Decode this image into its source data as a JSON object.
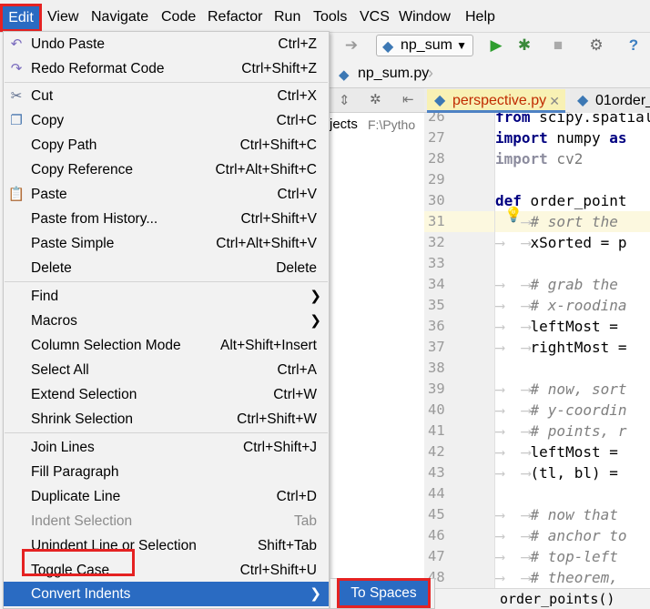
{
  "menubar": [
    "Edit",
    "View",
    "Navigate",
    "Code",
    "Refactor",
    "Run",
    "Tools",
    "VCS",
    "Window",
    "Help"
  ],
  "toolbar": {
    "run_config": "np_sum",
    "arrow_icon": "arrow-right-icon",
    "run_icon": "play-icon",
    "debug_icon": "bug-icon",
    "stop_icon": "stop-icon",
    "settings_icon": "wrench-icon",
    "help_icon": "question-icon"
  },
  "navbar": {
    "file": "np_sum.py"
  },
  "project": {
    "label": "jects",
    "path": "F:\\Pytho"
  },
  "tabs": [
    "perspective.py",
    "01order_"
  ],
  "menu": {
    "items": [
      {
        "label": "Undo Paste",
        "shortcut": "Ctrl+Z",
        "icon": "undo-icon"
      },
      {
        "label": "Redo Reformat Code",
        "shortcut": "Ctrl+Shift+Z",
        "icon": "redo-icon"
      },
      {
        "label": "Cut",
        "shortcut": "Ctrl+X",
        "icon": "scissors-icon"
      },
      {
        "label": "Copy",
        "shortcut": "Ctrl+C",
        "icon": "copy-icon"
      },
      {
        "label": "Copy Path",
        "shortcut": "Ctrl+Shift+C"
      },
      {
        "label": "Copy Reference",
        "shortcut": "Ctrl+Alt+Shift+C"
      },
      {
        "label": "Paste",
        "shortcut": "Ctrl+V",
        "icon": "paste-icon"
      },
      {
        "label": "Paste from History...",
        "shortcut": "Ctrl+Shift+V"
      },
      {
        "label": "Paste Simple",
        "shortcut": "Ctrl+Alt+Shift+V"
      },
      {
        "label": "Delete",
        "shortcut": "Delete"
      },
      {
        "label": "Find",
        "shortcut": ""
      },
      {
        "label": "Macros",
        "shortcut": ""
      },
      {
        "label": "Column Selection Mode",
        "shortcut": "Alt+Shift+Insert"
      },
      {
        "label": "Select All",
        "shortcut": "Ctrl+A"
      },
      {
        "label": "Extend Selection",
        "shortcut": "Ctrl+W"
      },
      {
        "label": "Shrink Selection",
        "shortcut": "Ctrl+Shift+W"
      },
      {
        "label": "Join Lines",
        "shortcut": "Ctrl+Shift+J"
      },
      {
        "label": "Fill Paragraph",
        "shortcut": ""
      },
      {
        "label": "Duplicate Line",
        "shortcut": "Ctrl+D"
      },
      {
        "label": "Indent Selection",
        "shortcut": "Tab"
      },
      {
        "label": "Unindent Line or Selection",
        "shortcut": "Shift+Tab"
      },
      {
        "label": "Toggle Case",
        "shortcut": "Ctrl+Shift+U"
      },
      {
        "label": "Convert Indents",
        "shortcut": ""
      }
    ],
    "submenu": {
      "label": "To Spaces"
    }
  },
  "editor": {
    "line_numbers": [
      "26",
      "27",
      "28",
      "29",
      "30",
      "31",
      "32",
      "33",
      "34",
      "35",
      "36",
      "37",
      "38",
      "39",
      "40",
      "41",
      "42",
      "43",
      "44",
      "45",
      "46",
      "47",
      "48"
    ],
    "status": "order_points()"
  },
  "colors": {
    "accent": "#2a6bc2",
    "highlight_box": "#e52222"
  }
}
